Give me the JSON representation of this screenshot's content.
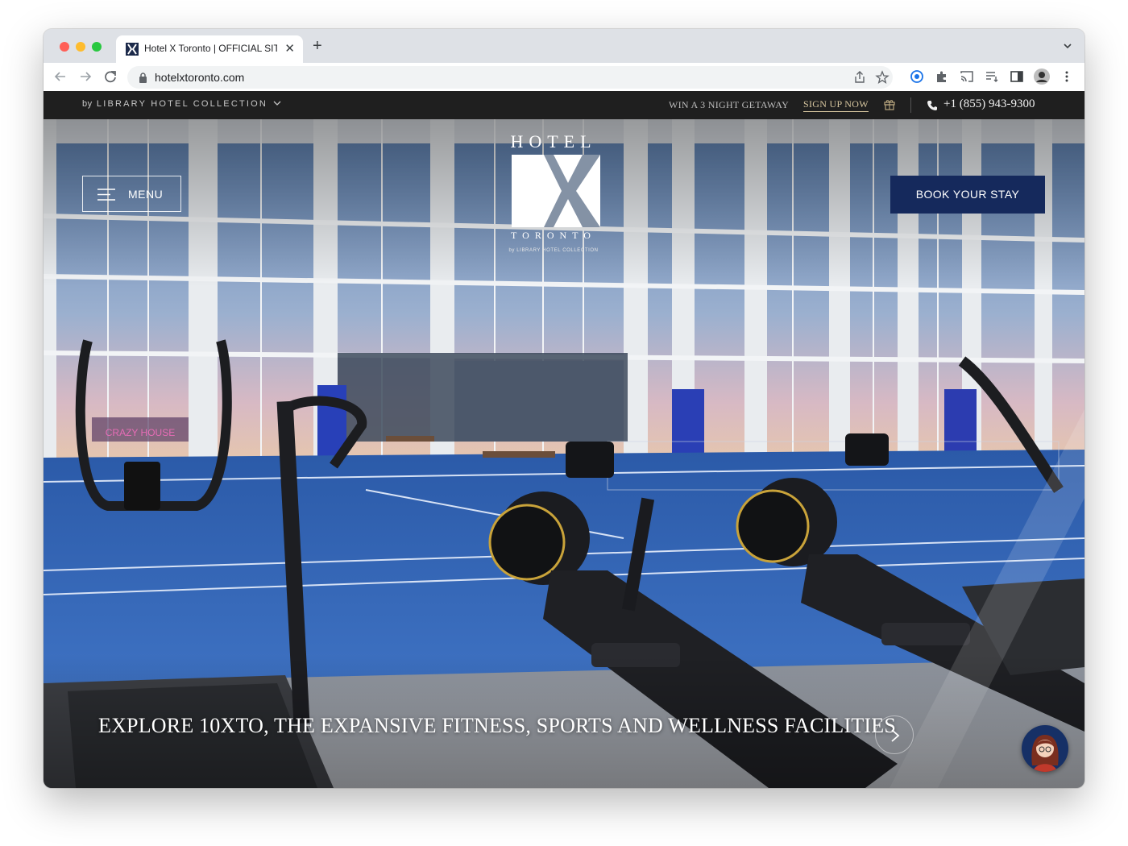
{
  "browser": {
    "tab_title": "Hotel X Toronto | OFFICIAL SITE",
    "new_tab_symbol": "+",
    "close_symbol": "✕",
    "url": "hotelxtoronto.com"
  },
  "topbar": {
    "by": "by",
    "collection": "LIBRARY HOTEL COLLECTION",
    "promo": "WIN A 3 NIGHT GETAWAY",
    "signup": "SIGN UP NOW",
    "phone": "+1 (855) 943-9300"
  },
  "header": {
    "menu_label": "MENU",
    "book_label": "BOOK YOUR STAY"
  },
  "logo": {
    "hotel": "HOTEL",
    "city": "TORONTO",
    "sub": "by LIBRARY HOTEL COLLECTION"
  },
  "hero": {
    "caption": "EXPLORE 10XTO, THE EXPANSIVE FITNESS, SPORTS AND WELLNESS FACILITIES"
  },
  "colors": {
    "topbar_bg": "#1f1f1f",
    "book_button": "#15295c",
    "signup_accent": "#d8c7a0",
    "court_blue": "#2f5fb0"
  },
  "icons": [
    "favicon",
    "back-arrow-icon",
    "forward-arrow-icon",
    "reload-icon",
    "lock-icon",
    "share-icon",
    "star-icon",
    "extension-icon",
    "puzzle-icon",
    "cast-icon",
    "reading-list-icon",
    "sidebar-icon",
    "profile-avatar",
    "kebab-menu-icon",
    "chevron-down-icon",
    "gift-icon",
    "phone-icon",
    "hamburger-icon",
    "chevron-right-icon",
    "chat-avatar-icon"
  ]
}
